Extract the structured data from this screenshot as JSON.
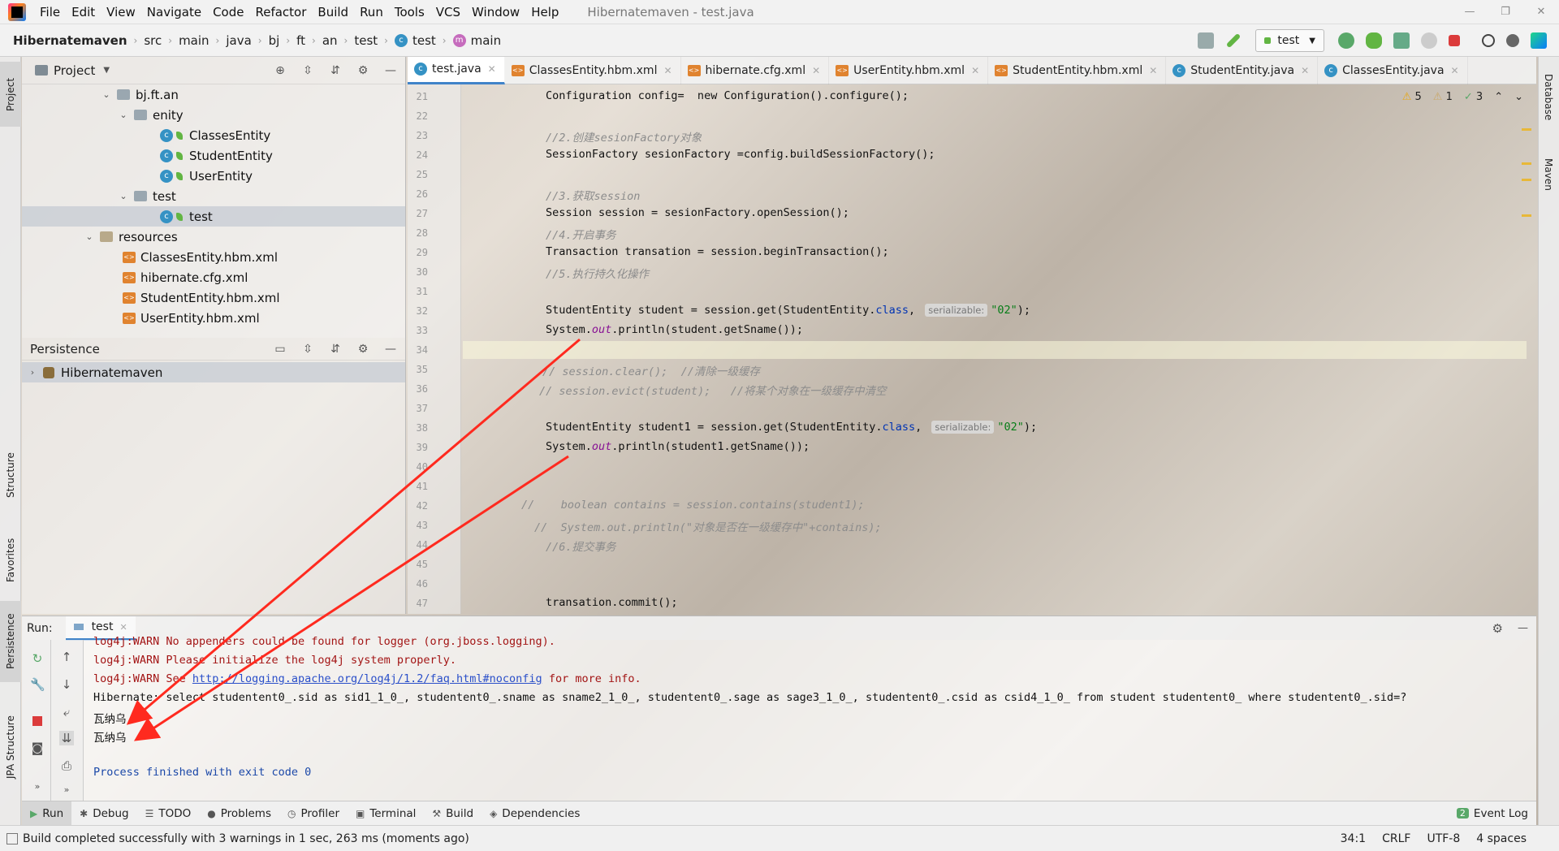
{
  "menubar": {
    "items": [
      "File",
      "Edit",
      "View",
      "Navigate",
      "Code",
      "Refactor",
      "Build",
      "Run",
      "Tools",
      "VCS",
      "Window",
      "Help"
    ],
    "title": "Hibernatemaven - test.java"
  },
  "navbar": {
    "crumbs": [
      "Hibernatemaven",
      "src",
      "main",
      "java",
      "bj",
      "ft",
      "an",
      "test",
      "test",
      "main"
    ],
    "run_config": "test"
  },
  "left_stripe": {
    "project": "Project",
    "structure": "Structure",
    "favorites": "Favorites",
    "persistence": "Persistence",
    "jpa": "JPA Structure"
  },
  "right_stripe": {
    "database": "Database",
    "maven": "Maven"
  },
  "project_panel": {
    "title": "Project",
    "tree": [
      {
        "label": "bj.ft.an",
        "type": "package"
      },
      {
        "label": "enity",
        "type": "package"
      },
      {
        "label": "ClassesEntity",
        "type": "class"
      },
      {
        "label": "StudentEntity",
        "type": "class"
      },
      {
        "label": "UserEntity",
        "type": "class"
      },
      {
        "label": "test",
        "type": "package"
      },
      {
        "label": "test",
        "type": "class"
      },
      {
        "label": "resources",
        "type": "folder"
      },
      {
        "label": "ClassesEntity.hbm.xml",
        "type": "xml"
      },
      {
        "label": "hibernate.cfg.xml",
        "type": "xml"
      },
      {
        "label": "StudentEntity.hbm.xml",
        "type": "xml"
      },
      {
        "label": "UserEntity.hbm.xml",
        "type": "xml"
      }
    ]
  },
  "persistence_panel": {
    "title": "Persistence",
    "item": "Hibernatemaven"
  },
  "editor": {
    "tabs": [
      "test.java",
      "ClassesEntity.hbm.xml",
      "hibernate.cfg.xml",
      "UserEntity.hbm.xml",
      "StudentEntity.hbm.xml",
      "StudentEntity.java",
      "ClassesEntity.java"
    ],
    "inspections": {
      "warnings": "5",
      "weak": "1",
      "ok": "3"
    },
    "line_numbers": [
      "21",
      "22",
      "23",
      "24",
      "25",
      "26",
      "27",
      "28",
      "29",
      "30",
      "31",
      "32",
      "33",
      "34",
      "35",
      "36",
      "37",
      "38",
      "39",
      "40",
      "41",
      "42",
      "43",
      "44",
      "45",
      "46",
      "47"
    ],
    "code": {
      "l21": "Configuration config=  new Configuration().configure();",
      "l23": "//2.创建sesionFactory对象",
      "l24": "SessionFactory sesionFactory =config.buildSessionFactory();",
      "l26": "//3.获取session",
      "l27": "Session session = sesionFactory.openSession();",
      "l28": "//4.开启事务",
      "l29": "Transaction transation = session.beginTransaction();",
      "l30": "//5.执行持久化操作",
      "l32a": "StudentEntity student = session.get(StudentEntity.",
      "l32b": "class",
      "l32c": ", ",
      "l32hint": "serializable:",
      "l32d": "\"02\"",
      "l32e": ");",
      "l33a": "System.",
      "l33b": "out",
      "l33c": ".println(student.getSname());",
      "l35": "// session.clear();  //清除一级缓存",
      "l36": "// session.evict(student);   //将某个对象在一级缓存中清空",
      "l38a": "StudentEntity student1 = session.get(StudentEntity.",
      "l38b": "class",
      "l38c": ", ",
      "l38hint": "serializable:",
      "l38d": "\"02\"",
      "l38e": ");",
      "l39a": "System.",
      "l39b": "out",
      "l39c": ".println(student1.getSname());",
      "l42": "//    boolean contains = session.contains(student1);",
      "l43": "//  System.out.println(\"对象是否在一级缓存中\"+contains);",
      "l44": "//6.提交事务",
      "l47": "transation.commit();"
    }
  },
  "run_panel": {
    "label": "Run:",
    "tab": "test",
    "console": {
      "c1": "log4j:WARN No appenders could be found for logger (org.jboss.logging).",
      "c2": "log4j:WARN Please initialize the log4j system properly.",
      "c3a": "log4j:WARN See ",
      "c3link": "http://logging.apache.org/log4j/1.2/faq.html#noconfig",
      "c3b": " for more info.",
      "c4": "Hibernate: select studentent0_.sid as sid1_1_0_, studentent0_.sname as sname2_1_0_, studentent0_.sage as sage3_1_0_, studentent0_.csid as csid4_1_0_ from student studentent0_ where studentent0_.sid=?",
      "c5": "瓦纳乌",
      "c6": "瓦纳乌",
      "c8": "Process finished with exit code 0"
    }
  },
  "bottom_tabs": [
    "Run",
    "Debug",
    "TODO",
    "Problems",
    "Profiler",
    "Terminal",
    "Build",
    "Dependencies"
  ],
  "event_log": {
    "count": "2",
    "label": "Event Log"
  },
  "status": {
    "message": "Build completed successfully with 3 warnings in 1 sec, 263 ms (moments ago)",
    "position": "34:1",
    "line_sep": "CRLF",
    "encoding": "UTF-8",
    "indent": "4 spaces"
  },
  "colors": {
    "accent": "#4083c9",
    "arrow": "#ff2a1f",
    "keyword": "#0033b3",
    "string": "#067d17",
    "comment": "#8c8c8c"
  }
}
